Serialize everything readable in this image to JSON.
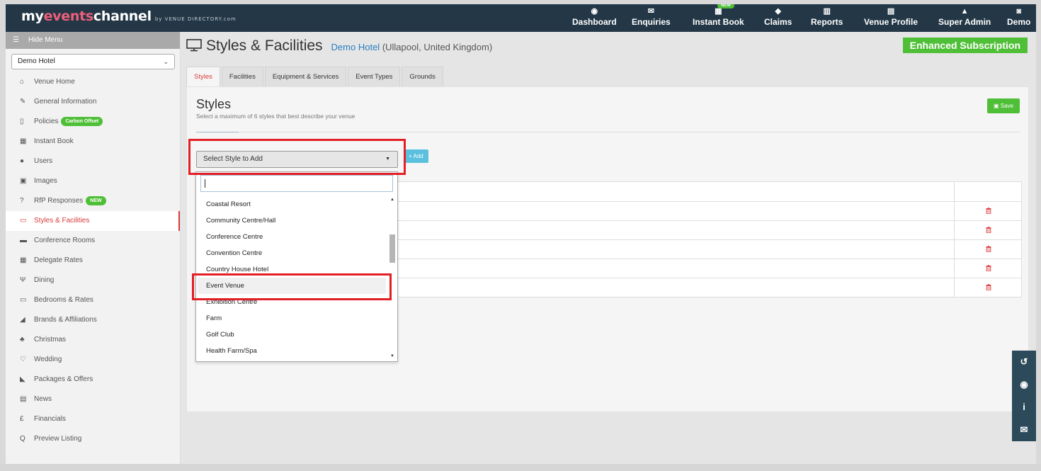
{
  "topbar": {
    "logo_prefix": "my",
    "logo_accent": "events",
    "logo_suffix": "channel",
    "logo_by": "by VENUE DIRECTORY.com",
    "nav": [
      {
        "name": "dashboard",
        "label": "Dashboard",
        "icon": "dashboard-icon",
        "glyph": "◉"
      },
      {
        "name": "enquiries",
        "label": "Enquiries",
        "icon": "envelope-icon",
        "glyph": "✉"
      },
      {
        "name": "instant-book",
        "label": "Instant Book",
        "icon": "calendar-icon",
        "glyph": "▦",
        "badge": "NEW"
      },
      {
        "name": "claims",
        "label": "Claims",
        "icon": "tag-icon",
        "glyph": "◆"
      },
      {
        "name": "reports",
        "label": "Reports",
        "icon": "bar-chart-icon",
        "glyph": "▥"
      },
      {
        "name": "venue-profile",
        "label": "Venue Profile",
        "icon": "building-icon",
        "glyph": "▤"
      },
      {
        "name": "super-admin",
        "label": "Super Admin",
        "icon": "lock-icon",
        "glyph": "▲"
      },
      {
        "name": "demo",
        "label": "Demo",
        "icon": "user-icon",
        "glyph": "◙"
      }
    ]
  },
  "sidebar": {
    "hide_menu": "Hide Menu",
    "venue_select": "Demo Hotel",
    "items": [
      {
        "label": "Venue Home",
        "icon": "home-icon",
        "glyph": "⌂"
      },
      {
        "label": "General Information",
        "icon": "edit-icon",
        "glyph": "✎"
      },
      {
        "label": "Policies",
        "icon": "file-icon",
        "glyph": "▯",
        "pill": "Carbon Offset"
      },
      {
        "label": "Instant Book",
        "icon": "calendar-icon",
        "glyph": "▦"
      },
      {
        "label": "Users",
        "icon": "user-icon",
        "glyph": "●"
      },
      {
        "label": "Images",
        "icon": "image-icon",
        "glyph": "▣"
      },
      {
        "label": "RfP Responses",
        "icon": "question-icon",
        "glyph": "?",
        "pill": "NEW"
      },
      {
        "label": "Styles & Facilities",
        "icon": "monitor-icon",
        "glyph": "▭",
        "active": true
      },
      {
        "label": "Conference Rooms",
        "icon": "briefcase-icon",
        "glyph": "▬"
      },
      {
        "label": "Delegate Rates",
        "icon": "calculator-icon",
        "glyph": "▦"
      },
      {
        "label": "Dining",
        "icon": "cutlery-icon",
        "glyph": "Ψ"
      },
      {
        "label": "Bedrooms & Rates",
        "icon": "bed-icon",
        "glyph": "▭"
      },
      {
        "label": "Brands & Affiliations",
        "icon": "bookmark-icon",
        "glyph": "◢"
      },
      {
        "label": "Christmas",
        "icon": "tree-icon",
        "glyph": "♣"
      },
      {
        "label": "Wedding",
        "icon": "heart-icon",
        "glyph": "♡"
      },
      {
        "label": "Packages & Offers",
        "icon": "tags-icon",
        "glyph": "◣"
      },
      {
        "label": "News",
        "icon": "newspaper-icon",
        "glyph": "▤"
      },
      {
        "label": "Financials",
        "icon": "pound-icon",
        "glyph": "£"
      },
      {
        "label": "Preview Listing",
        "icon": "search-icon",
        "glyph": "Q"
      }
    ]
  },
  "header": {
    "title": "Styles & Facilities",
    "venue_link": "Demo Hotel",
    "venue_location": "(Ullapool, United Kingdom)",
    "subscription": "Enhanced Subscription"
  },
  "tabs": [
    "Styles",
    "Facilities",
    "Equipment & Services",
    "Event Types",
    "Grounds"
  ],
  "styles_section": {
    "title": "Styles",
    "subtitle": "Select a maximum of 6 styles that best describe your venue",
    "save": "Save",
    "select_placeholder": "Select Style to Add",
    "add": "+ Add",
    "row_count": 5
  },
  "dropdown": {
    "options": [
      "Coastal Resort",
      "Community Centre/Hall",
      "Conference Centre",
      "Convention Centre",
      "Country House Hotel",
      "Event Venue",
      "Exhibition Centre",
      "Farm",
      "Golf Club",
      "Health Farm/Spa"
    ],
    "highlighted": "Event Venue"
  },
  "float_buttons": [
    {
      "icon": "history-icon",
      "glyph": "↺"
    },
    {
      "icon": "chat-icon",
      "glyph": "◉"
    },
    {
      "icon": "info-icon",
      "glyph": "i"
    },
    {
      "icon": "envelope-icon",
      "glyph": "✉"
    }
  ],
  "colors": {
    "topbar": "#233746",
    "accent_green": "#4fbf37",
    "active_red": "#d83b3b",
    "highlight_box": "#e31e25",
    "link_blue": "#2a7fc0"
  }
}
